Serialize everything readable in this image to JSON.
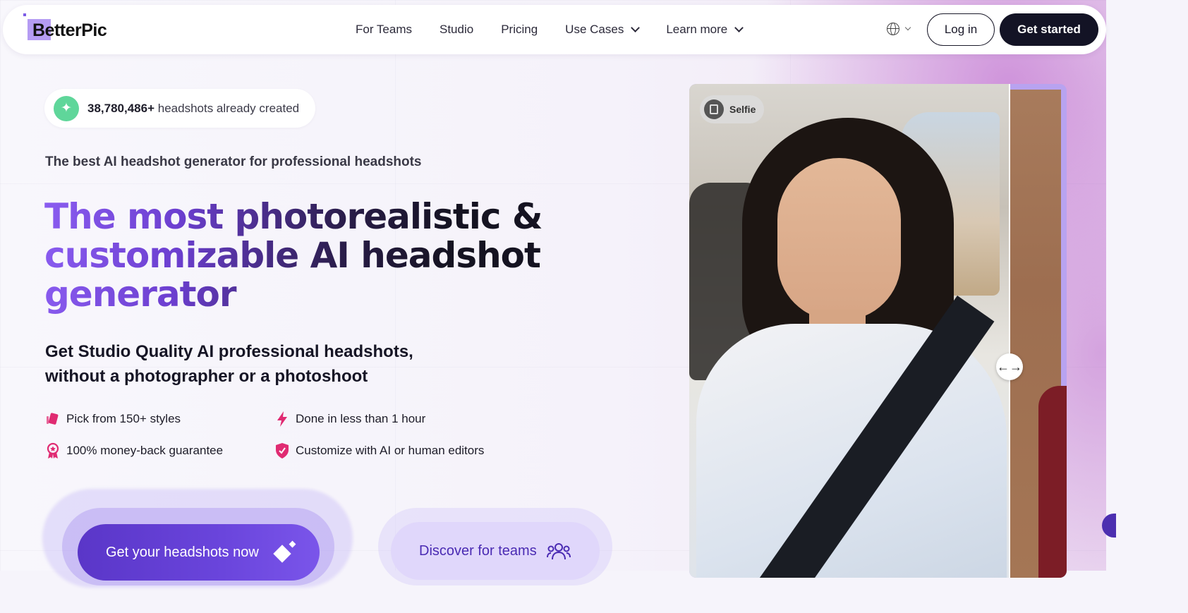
{
  "brand": {
    "name": "BetterPic"
  },
  "nav": {
    "links": [
      {
        "label": "For Teams"
      },
      {
        "label": "Studio"
      },
      {
        "label": "Pricing"
      },
      {
        "label": "Use Cases",
        "dropdown": true
      },
      {
        "label": "Learn more",
        "dropdown": true
      }
    ],
    "language_icon": "globe-icon",
    "login_label": "Log in",
    "cta_label": "Get started"
  },
  "hero": {
    "counter_value": "38,780,486+",
    "counter_suffix": "headshots already created",
    "tagline": "The best AI headshot generator for professional headshots",
    "headline_line1": "The most photorealistic &",
    "headline_line2": "customizable AI headshot",
    "headline_line3": "generator",
    "subhead": "Get Studio Quality AI professional headshots, without a photographer or a photoshoot",
    "features": [
      {
        "label": "Pick from 150+ styles",
        "icon": "styles-icon"
      },
      {
        "label": "Done in less than 1 hour",
        "icon": "lightning-icon"
      },
      {
        "label": "100% money-back guarantee",
        "icon": "award-icon"
      },
      {
        "label": "Customize with AI or human editors",
        "icon": "shield-icon"
      }
    ],
    "primary_cta": "Get your headshots now",
    "secondary_cta": "Discover for teams"
  },
  "comparison": {
    "before_label": "Selfie"
  },
  "colors": {
    "accent": "#6a45dc",
    "dark": "#131325",
    "feature_icon": "#e02b72",
    "counter_icon_bg": "#5fd69a"
  }
}
